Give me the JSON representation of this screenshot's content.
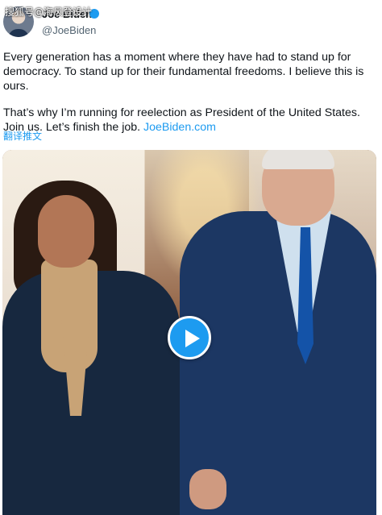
{
  "watermark": "搜狐号@海风登设计",
  "author": {
    "display_name": "Joe Biden",
    "handle": "@JoeBiden"
  },
  "tweet": {
    "paragraph_1": "Every generation has a moment where they have had to stand up for democracy. To stand up for their fundamental freedoms. I believe this is ours.",
    "paragraph_2_text": "That’s why I’m running for reelection as President of the United States. Join us. Let’s finish the job. ",
    "paragraph_2_link": "JoeBiden.com",
    "translate_label": "翻译推文"
  },
  "media": {
    "type": "video",
    "play_icon": "play-icon"
  },
  "colors": {
    "link": "#1d9bf0",
    "verified": "#1d9bf0",
    "handle": "#536471",
    "text": "#0f1419"
  }
}
